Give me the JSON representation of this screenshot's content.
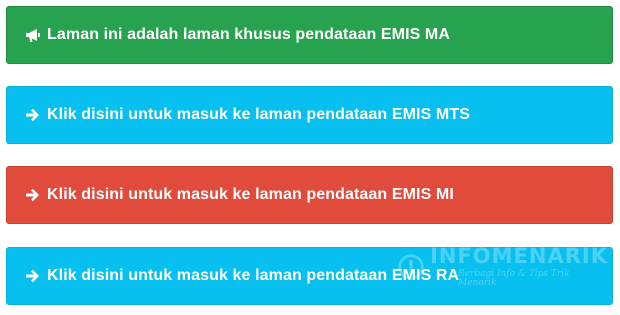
{
  "colors": {
    "green": "#27a24f",
    "cyan": "#08c0ef",
    "red": "#e04b3b"
  },
  "banners": [
    {
      "icon": "bullhorn-icon",
      "text": "Laman ini adalah laman khusus pendataan EMIS MA"
    },
    {
      "icon": "arrow-right-icon",
      "text": "Klik disini untuk masuk ke laman pendataan EMIS MTS"
    },
    {
      "icon": "arrow-right-icon",
      "text": "Klik disini untuk masuk ke laman pendataan EMIS MI"
    },
    {
      "icon": "arrow-right-icon",
      "text": "Klik disini untuk masuk ke laman pendataan EMIS RA"
    }
  ],
  "watermark": {
    "title": "INFOMENARIK",
    "subtitle": "Berbagi Info & Tips Trik Menarik"
  }
}
